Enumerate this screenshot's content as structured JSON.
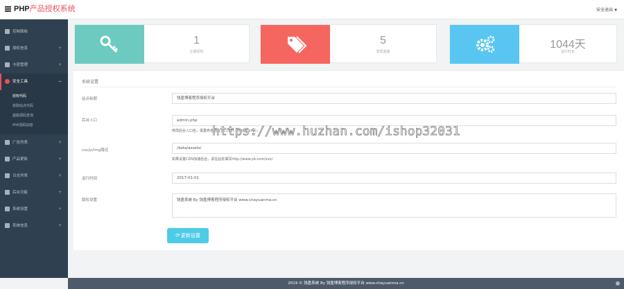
{
  "header": {
    "brand_part1": "PHP",
    "brand_part2": "产品授权系统",
    "logout_label": "安全退出"
  },
  "sidebar": {
    "items": [
      {
        "label": "控制面板",
        "arrow": ""
      },
      {
        "label": "授权信息",
        "arrow": "+"
      },
      {
        "label": "卡密管理",
        "arrow": "+"
      },
      {
        "label": "安全工具",
        "arrow": "−"
      }
    ],
    "sub_items": [
      "授权代码",
      "获取站点代码",
      "盗版源码查询",
      "PHP源码加密"
    ],
    "items_after": [
      {
        "label": "广告列表",
        "arrow": "+"
      },
      {
        "label": "产品更新",
        "arrow": "+"
      },
      {
        "label": "日志列表",
        "arrow": "+"
      },
      {
        "label": "后台功能",
        "arrow": "+"
      },
      {
        "label": "系统设置",
        "arrow": "+"
      },
      {
        "label": "系统信息",
        "arrow": "+"
      }
    ]
  },
  "stats": [
    {
      "value": "1",
      "label": "正版授权",
      "icon": "key-icon",
      "color": "#6dcac0"
    },
    {
      "value": "5",
      "label": "发现盗版",
      "icon": "tags-icon",
      "color": "#f66660"
    },
    {
      "value": "1044天",
      "label": "运行时长",
      "icon": "gears-icon",
      "color": "#58c6f1"
    }
  ],
  "settings": {
    "title": "系统设置",
    "fields": {
      "site_title": {
        "label": "站点标题",
        "value": "钱盈博客程序授权平台"
      },
      "admin_entry": {
        "label": "后台入口",
        "value": "admin.php",
        "help": "修改后台入口名，需重命名后台入口文件（index.php）。"
      },
      "css_path": {
        "label": "css/js/img路径",
        "value": "/data/assets/",
        "help": "如果设置CDN加速后台，请在此处填写http://www.yb.com/xxx/"
      },
      "start_date": {
        "label": "运行时间",
        "value": "2017-01-01"
      },
      "copyright": {
        "label": "版权设置",
        "value": "钱盈系统 By 钱盈博客程序授权平台 www.chayuanma.cn"
      }
    },
    "watermark": "https://www.huzhan.com/ishop32031",
    "save_label": "更新设置"
  },
  "footer": {
    "text": "2019 © 钱盈系统 By 钱盈博客程序授权平台 www.chayuanma.cn"
  }
}
